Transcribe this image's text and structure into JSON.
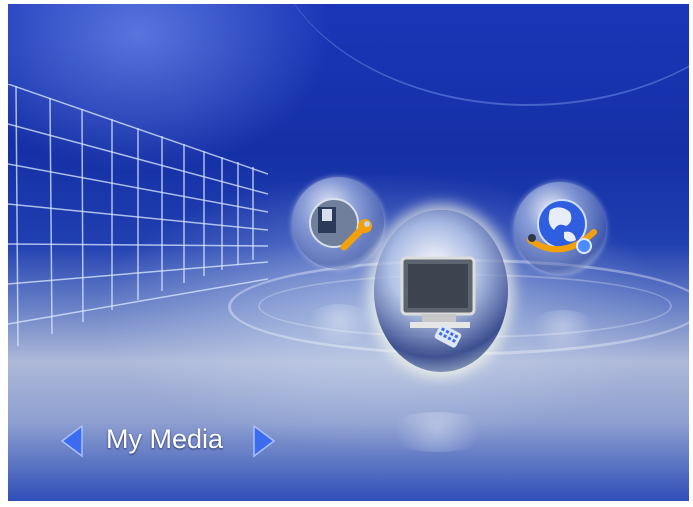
{
  "menu": {
    "current_label": "My Media",
    "items": [
      {
        "name": "setup",
        "icon": "setup-disk-wrench-icon"
      },
      {
        "name": "my-media",
        "icon": "tv-monitor-icon",
        "selected": true
      },
      {
        "name": "network",
        "icon": "globe-network-icon"
      }
    ],
    "prev_icon": "left-arrow-icon",
    "next_icon": "right-arrow-icon"
  },
  "colors": {
    "background_top": "#1530a6",
    "floor": "#aeb9d9",
    "arrow": "#3b6cf0",
    "label": "#ffffff",
    "selection_glow": "#fffbe0"
  }
}
